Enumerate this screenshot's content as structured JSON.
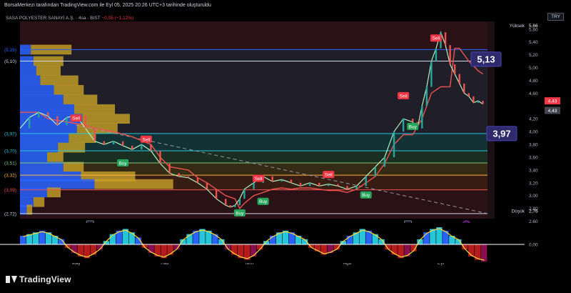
{
  "header": {
    "attribution": "BorsaMerkezi tarafından TradingView.com ile Eyl 05, 2025 20:26 UTC+3 tarihinde oluşturuldu",
    "symbol_line": "SASA POLYESTER SANAYİ A.Ş. · 4sa · BIST",
    "change": "−0,05 (−1,12%)",
    "currency": "TRY"
  },
  "brand": {
    "name": "TradingView"
  },
  "chart_data": {
    "type": "line",
    "ylim": [
      2.64,
      5.72
    ],
    "yticks": [
      {
        "v": 5.6,
        "label": "5,60"
      },
      {
        "v": 5.4,
        "label": "5,40"
      },
      {
        "v": 5.2,
        "label": "5,20"
      },
      {
        "v": 5.0,
        "label": "5,00"
      },
      {
        "v": 4.8,
        "label": "4,80"
      },
      {
        "v": 4.6,
        "label": "4,60"
      },
      {
        "v": 4.2,
        "label": "4,20"
      },
      {
        "v": 4.0,
        "label": "4,00"
      },
      {
        "v": 3.8,
        "label": "3,80"
      },
      {
        "v": 3.6,
        "label": "3,60"
      },
      {
        "v": 3.4,
        "label": "3,40"
      },
      {
        "v": 3.2,
        "label": "3,20"
      },
      {
        "v": 3.0,
        "label": "3,00"
      },
      {
        "v": 2.8,
        "label": "2,80"
      },
      {
        "v": 2.6,
        "label": "2,60"
      }
    ],
    "xlabels": [
      {
        "x": 0.12,
        "label": "May"
      },
      {
        "x": 0.31,
        "label": "Haz"
      },
      {
        "x": 0.49,
        "label": "Tem"
      },
      {
        "x": 0.7,
        "label": "Ağu"
      },
      {
        "x": 0.9,
        "label": "Eyl"
      }
    ],
    "price": [
      [
        0.0,
        4.05
      ],
      [
        0.02,
        4.22
      ],
      [
        0.04,
        4.3
      ],
      [
        0.06,
        4.24
      ],
      [
        0.08,
        4.1
      ],
      [
        0.1,
        4.22
      ],
      [
        0.12,
        4.25
      ],
      [
        0.14,
        4.05
      ],
      [
        0.16,
        3.85
      ],
      [
        0.18,
        3.8
      ],
      [
        0.2,
        3.85
      ],
      [
        0.22,
        3.78
      ],
      [
        0.24,
        3.72
      ],
      [
        0.26,
        3.8
      ],
      [
        0.28,
        3.7
      ],
      [
        0.3,
        3.5
      ],
      [
        0.32,
        3.35
      ],
      [
        0.34,
        3.3
      ],
      [
        0.36,
        3.28
      ],
      [
        0.38,
        3.2
      ],
      [
        0.4,
        3.1
      ],
      [
        0.42,
        2.95
      ],
      [
        0.44,
        2.85
      ],
      [
        0.45,
        2.82
      ],
      [
        0.46,
        2.85
      ],
      [
        0.47,
        2.95
      ],
      [
        0.48,
        3.1
      ],
      [
        0.5,
        3.2
      ],
      [
        0.52,
        3.3
      ],
      [
        0.54,
        3.22
      ],
      [
        0.56,
        3.25
      ],
      [
        0.58,
        3.2
      ],
      [
        0.6,
        3.15
      ],
      [
        0.62,
        3.2
      ],
      [
        0.64,
        3.15
      ],
      [
        0.66,
        3.18
      ],
      [
        0.68,
        3.15
      ],
      [
        0.7,
        3.1
      ],
      [
        0.72,
        3.15
      ],
      [
        0.74,
        3.3
      ],
      [
        0.76,
        3.45
      ],
      [
        0.78,
        3.6
      ],
      [
        0.8,
        4.0
      ],
      [
        0.82,
        4.2
      ],
      [
        0.84,
        4.15
      ],
      [
        0.85,
        4.05
      ],
      [
        0.86,
        4.4
      ],
      [
        0.87,
        4.7
      ],
      [
        0.88,
        5.1
      ],
      [
        0.89,
        5.3
      ],
      [
        0.9,
        5.55
      ],
      [
        0.91,
        5.35
      ],
      [
        0.92,
        5.05
      ],
      [
        0.93,
        4.9
      ],
      [
        0.94,
        4.75
      ],
      [
        0.95,
        4.6
      ],
      [
        0.96,
        4.55
      ],
      [
        0.97,
        4.45
      ],
      [
        0.98,
        4.48
      ],
      [
        0.99,
        4.43
      ]
    ],
    "trail": [
      [
        0.0,
        4.3
      ],
      [
        0.04,
        4.3
      ],
      [
        0.06,
        4.2
      ],
      [
        0.1,
        4.15
      ],
      [
        0.14,
        4.1
      ],
      [
        0.16,
        4.05
      ],
      [
        0.2,
        4.0
      ],
      [
        0.24,
        3.92
      ],
      [
        0.28,
        3.8
      ],
      [
        0.3,
        3.6
      ],
      [
        0.32,
        3.45
      ],
      [
        0.36,
        3.4
      ],
      [
        0.38,
        3.28
      ],
      [
        0.4,
        3.2
      ],
      [
        0.42,
        3.1
      ],
      [
        0.44,
        3.0
      ],
      [
        0.46,
        2.95
      ],
      [
        0.47,
        2.8
      ],
      [
        0.48,
        2.88
      ],
      [
        0.5,
        3.0
      ],
      [
        0.52,
        3.05
      ],
      [
        0.54,
        3.1
      ],
      [
        0.56,
        3.12
      ],
      [
        0.58,
        3.1
      ],
      [
        0.6,
        3.12
      ],
      [
        0.62,
        3.12
      ],
      [
        0.64,
        3.1
      ],
      [
        0.66,
        3.08
      ],
      [
        0.68,
        3.08
      ],
      [
        0.7,
        3.05
      ],
      [
        0.72,
        3.1
      ],
      [
        0.74,
        3.2
      ],
      [
        0.76,
        3.3
      ],
      [
        0.78,
        3.5
      ],
      [
        0.8,
        3.8
      ],
      [
        0.82,
        3.95
      ],
      [
        0.84,
        3.95
      ],
      [
        0.86,
        4.2
      ],
      [
        0.88,
        4.6
      ],
      [
        0.9,
        4.7
      ],
      [
        0.92,
        4.7
      ],
      [
        0.93,
        5.3
      ],
      [
        0.94,
        5.3
      ],
      [
        0.96,
        5.1
      ],
      [
        0.98,
        4.95
      ],
      [
        0.99,
        4.9
      ]
    ],
    "dashed_trend": [
      [
        0.12,
        4.1
      ],
      [
        1.0,
        2.72
      ]
    ],
    "levels": [
      {
        "v": 5.28,
        "label": "(5,28)",
        "color": "#2962ff"
      },
      {
        "v": 5.1,
        "label": "(5,10)",
        "color": "#cfd6e6"
      },
      {
        "v": 3.97,
        "label": "(3,97)",
        "color": "#26c6da"
      },
      {
        "v": 3.7,
        "label": "(3,70)",
        "color": "#26c6da"
      },
      {
        "v": 3.51,
        "label": "(3,51)",
        "color": "#81c784"
      },
      {
        "v": 3.32,
        "label": "(3,32)",
        "color": "#ffb74d"
      },
      {
        "v": 3.09,
        "label": "(3,09)",
        "color": "#ef5350"
      },
      {
        "v": 2.72,
        "label": "(2,72)",
        "color": "#cfd6e6"
      }
    ],
    "volume_profile": [
      {
        "p": 5.28,
        "blue": 0.08,
        "gold": 0.3
      },
      {
        "p": 5.1,
        "blue": 0.1,
        "gold": 0.22
      },
      {
        "p": 4.95,
        "blue": 0.12,
        "gold": 0.18
      },
      {
        "p": 4.8,
        "blue": 0.15,
        "gold": 0.28
      },
      {
        "p": 4.65,
        "blue": 0.25,
        "gold": 0.22
      },
      {
        "p": 4.5,
        "blue": 0.32,
        "gold": 0.25
      },
      {
        "p": 4.35,
        "blue": 0.4,
        "gold": 0.3
      },
      {
        "p": 4.2,
        "blue": 0.46,
        "gold": 0.35
      },
      {
        "p": 4.05,
        "blue": 0.42,
        "gold": 0.3
      },
      {
        "p": 3.9,
        "blue": 0.36,
        "gold": 0.2
      },
      {
        "p": 3.75,
        "blue": 0.28,
        "gold": 0.2
      },
      {
        "p": 3.6,
        "blue": 0.2,
        "gold": 0.12
      },
      {
        "p": 3.45,
        "blue": 0.32,
        "gold": 0.15
      },
      {
        "p": 3.3,
        "blue": 0.45,
        "gold": 0.4
      },
      {
        "p": 3.18,
        "blue": 0.55,
        "gold": 0.58
      },
      {
        "p": 3.05,
        "blue": 0.2,
        "gold": 0.1
      },
      {
        "p": 2.9,
        "blue": 0.1,
        "gold": 0.08
      },
      {
        "p": 2.78,
        "blue": 0.05,
        "gold": 0.04
      }
    ],
    "signals": [
      {
        "type": "sell",
        "x": 0.12,
        "v": 4.2,
        "label": "Sell"
      },
      {
        "type": "sell",
        "x": 0.27,
        "v": 3.87,
        "label": "Sell"
      },
      {
        "type": "buy",
        "x": 0.22,
        "v": 3.5,
        "label": "Buy"
      },
      {
        "type": "buy",
        "x": 0.47,
        "v": 2.72,
        "label": "Buy"
      },
      {
        "type": "buy",
        "x": 0.52,
        "v": 2.9,
        "label": "Buy"
      },
      {
        "type": "sell",
        "x": 0.51,
        "v": 3.26,
        "label": "Sell"
      },
      {
        "type": "sell",
        "x": 0.66,
        "v": 3.32,
        "label": "Sell"
      },
      {
        "type": "buy",
        "x": 0.74,
        "v": 3.0,
        "label": "Buy"
      },
      {
        "type": "sell",
        "x": 0.82,
        "v": 4.55,
        "label": "Sell"
      },
      {
        "type": "buy",
        "x": 0.84,
        "v": 4.07,
        "label": "Buy"
      },
      {
        "type": "sell",
        "x": 0.89,
        "v": 5.45,
        "label": "Sell"
      }
    ],
    "callouts": [
      {
        "v": 5.13,
        "label": "5,13"
      },
      {
        "v": 3.97,
        "label": "3,97"
      }
    ],
    "price_tags": [
      {
        "v": 4.48,
        "label": "4,43",
        "bg": "#f23645"
      },
      {
        "v": 4.33,
        "label": "4,43",
        "bg": "#434651"
      }
    ],
    "high": {
      "label": "Yüksek",
      "value": "5,66",
      "v": 5.66
    },
    "low": {
      "label": "Düşük",
      "value": "2,76",
      "v": 2.76
    },
    "earnings_markers": [
      {
        "x": 0.15,
        "label": "E"
      },
      {
        "x": 0.83,
        "label": "E"
      }
    ],
    "oscillator": {
      "zero_label": "0,00",
      "bars": [
        0.5,
        0.6,
        0.7,
        0.8,
        0.7,
        0.5,
        0.3,
        -0.2,
        -0.5,
        -0.7,
        -0.8,
        -0.6,
        -0.3,
        0.2,
        0.6,
        0.8,
        0.9,
        0.7,
        0.4,
        -0.2,
        -0.5,
        -0.7,
        -0.8,
        -0.6,
        -0.3,
        0.3,
        0.6,
        0.8,
        0.9,
        0.8,
        0.6,
        0.3,
        -0.3,
        -0.6,
        -0.8,
        -0.9,
        -0.7,
        -0.3,
        0.2,
        0.5,
        0.7,
        0.8,
        0.7,
        0.5,
        0.3,
        -0.2,
        -0.4,
        -0.6,
        -0.5,
        -0.3,
        0.2,
        0.5,
        0.7,
        0.9,
        0.8,
        0.6,
        0.3,
        -0.3,
        -0.6,
        -0.8,
        -0.7,
        -0.4,
        0.3,
        0.7,
        0.9,
        1.0,
        0.8,
        0.5,
        0.3,
        -0.3,
        -0.7,
        -0.9,
        -1.0
      ]
    }
  }
}
